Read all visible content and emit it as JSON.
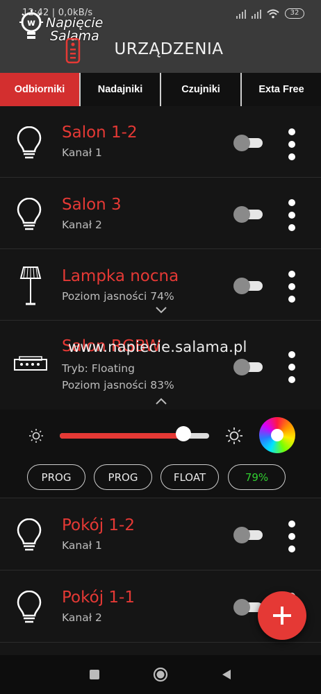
{
  "status_bar": {
    "time": "12:42 | 0,0kB/s",
    "battery": "32"
  },
  "logo": {
    "line1": "Napięcie",
    "line2": "Salama"
  },
  "header": {
    "title": "URZĄDZENIA"
  },
  "tabs": [
    {
      "label": "Odbiorniki",
      "active": true
    },
    {
      "label": "Nadajniki",
      "active": false
    },
    {
      "label": "Czujniki",
      "active": false
    },
    {
      "label": "Exta Free",
      "active": false
    }
  ],
  "devices": [
    {
      "name": "Salon 1-2",
      "sub": "Kanał 1",
      "icon": "bulb-icon",
      "on": false
    },
    {
      "name": "Salon 3",
      "sub": "Kanał 2",
      "icon": "bulb-icon",
      "on": false
    },
    {
      "name": "Lampka nocna",
      "sub": "Poziom jasności 74%",
      "icon": "floor-lamp-icon",
      "on": false
    },
    {
      "name": "Salon RGBW",
      "sub": "Tryb: Floating",
      "sub2": "Poziom jasności 83%",
      "icon": "led-controller-icon",
      "on": false
    },
    {
      "name": "Pokój 1-2",
      "sub": "Kanał 1",
      "icon": "bulb-icon",
      "on": false
    },
    {
      "name": "Pokój 1-1",
      "sub": "Kanał 2",
      "icon": "bulb-icon",
      "on": false
    }
  ],
  "panel": {
    "brightness_fraction": 0.83,
    "chips": [
      "PROG",
      "PROG",
      "FLOAT",
      "79%"
    ]
  },
  "watermark": "www.napiecie.salama.pl",
  "colors": {
    "accent": "#e53935",
    "tab_active": "#d32f2f",
    "value_green": "#30d030"
  }
}
